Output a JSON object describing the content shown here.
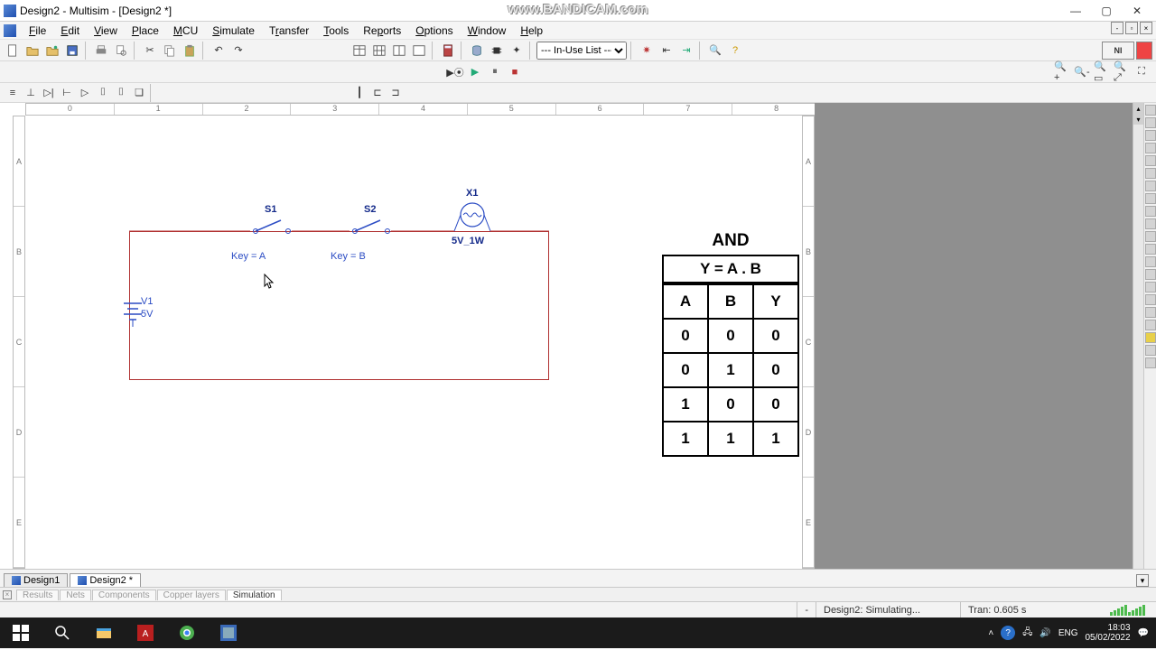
{
  "window": {
    "title": "Design2 - Multisim - [Design2 *]"
  },
  "watermark": "www.BANDICAM.com",
  "menus": [
    "File",
    "Edit",
    "View",
    "Place",
    "MCU",
    "Simulate",
    "Transfer",
    "Tools",
    "Reports",
    "Options",
    "Window",
    "Help"
  ],
  "inuse": {
    "selected": "--- In-Use List ---"
  },
  "rulerH": [
    "0",
    "1",
    "2",
    "3",
    "4",
    "5",
    "6",
    "7",
    "8"
  ],
  "rulerV": [
    "A",
    "B",
    "C",
    "D",
    "E"
  ],
  "circuit": {
    "s1": "S1",
    "s2": "S2",
    "x1": "X1",
    "keyA": "Key = A",
    "keyB": "Key = B",
    "bulb": "5V_1W",
    "v1a": "V1",
    "v1b": "5V"
  },
  "truth": {
    "title": "AND",
    "equation": "Y = A . B",
    "headers": [
      "A",
      "B",
      "Y"
    ],
    "rows": [
      [
        "0",
        "0",
        "0"
      ],
      [
        "0",
        "1",
        "0"
      ],
      [
        "1",
        "0",
        "0"
      ],
      [
        "1",
        "1",
        "1"
      ]
    ]
  },
  "tabs": {
    "t1": "Design1",
    "t2": "Design2 *"
  },
  "spread": {
    "results": "Results",
    "nets": "Nets",
    "components": "Components",
    "copper": "Copper layers",
    "simulation": "Simulation"
  },
  "status": {
    "sim": "Design2: Simulating...",
    "tran": "Tran: 0.605 s",
    "dash": "-"
  },
  "tray": {
    "lang": "ENG",
    "time": "18:03",
    "date": "05/02/2022"
  }
}
